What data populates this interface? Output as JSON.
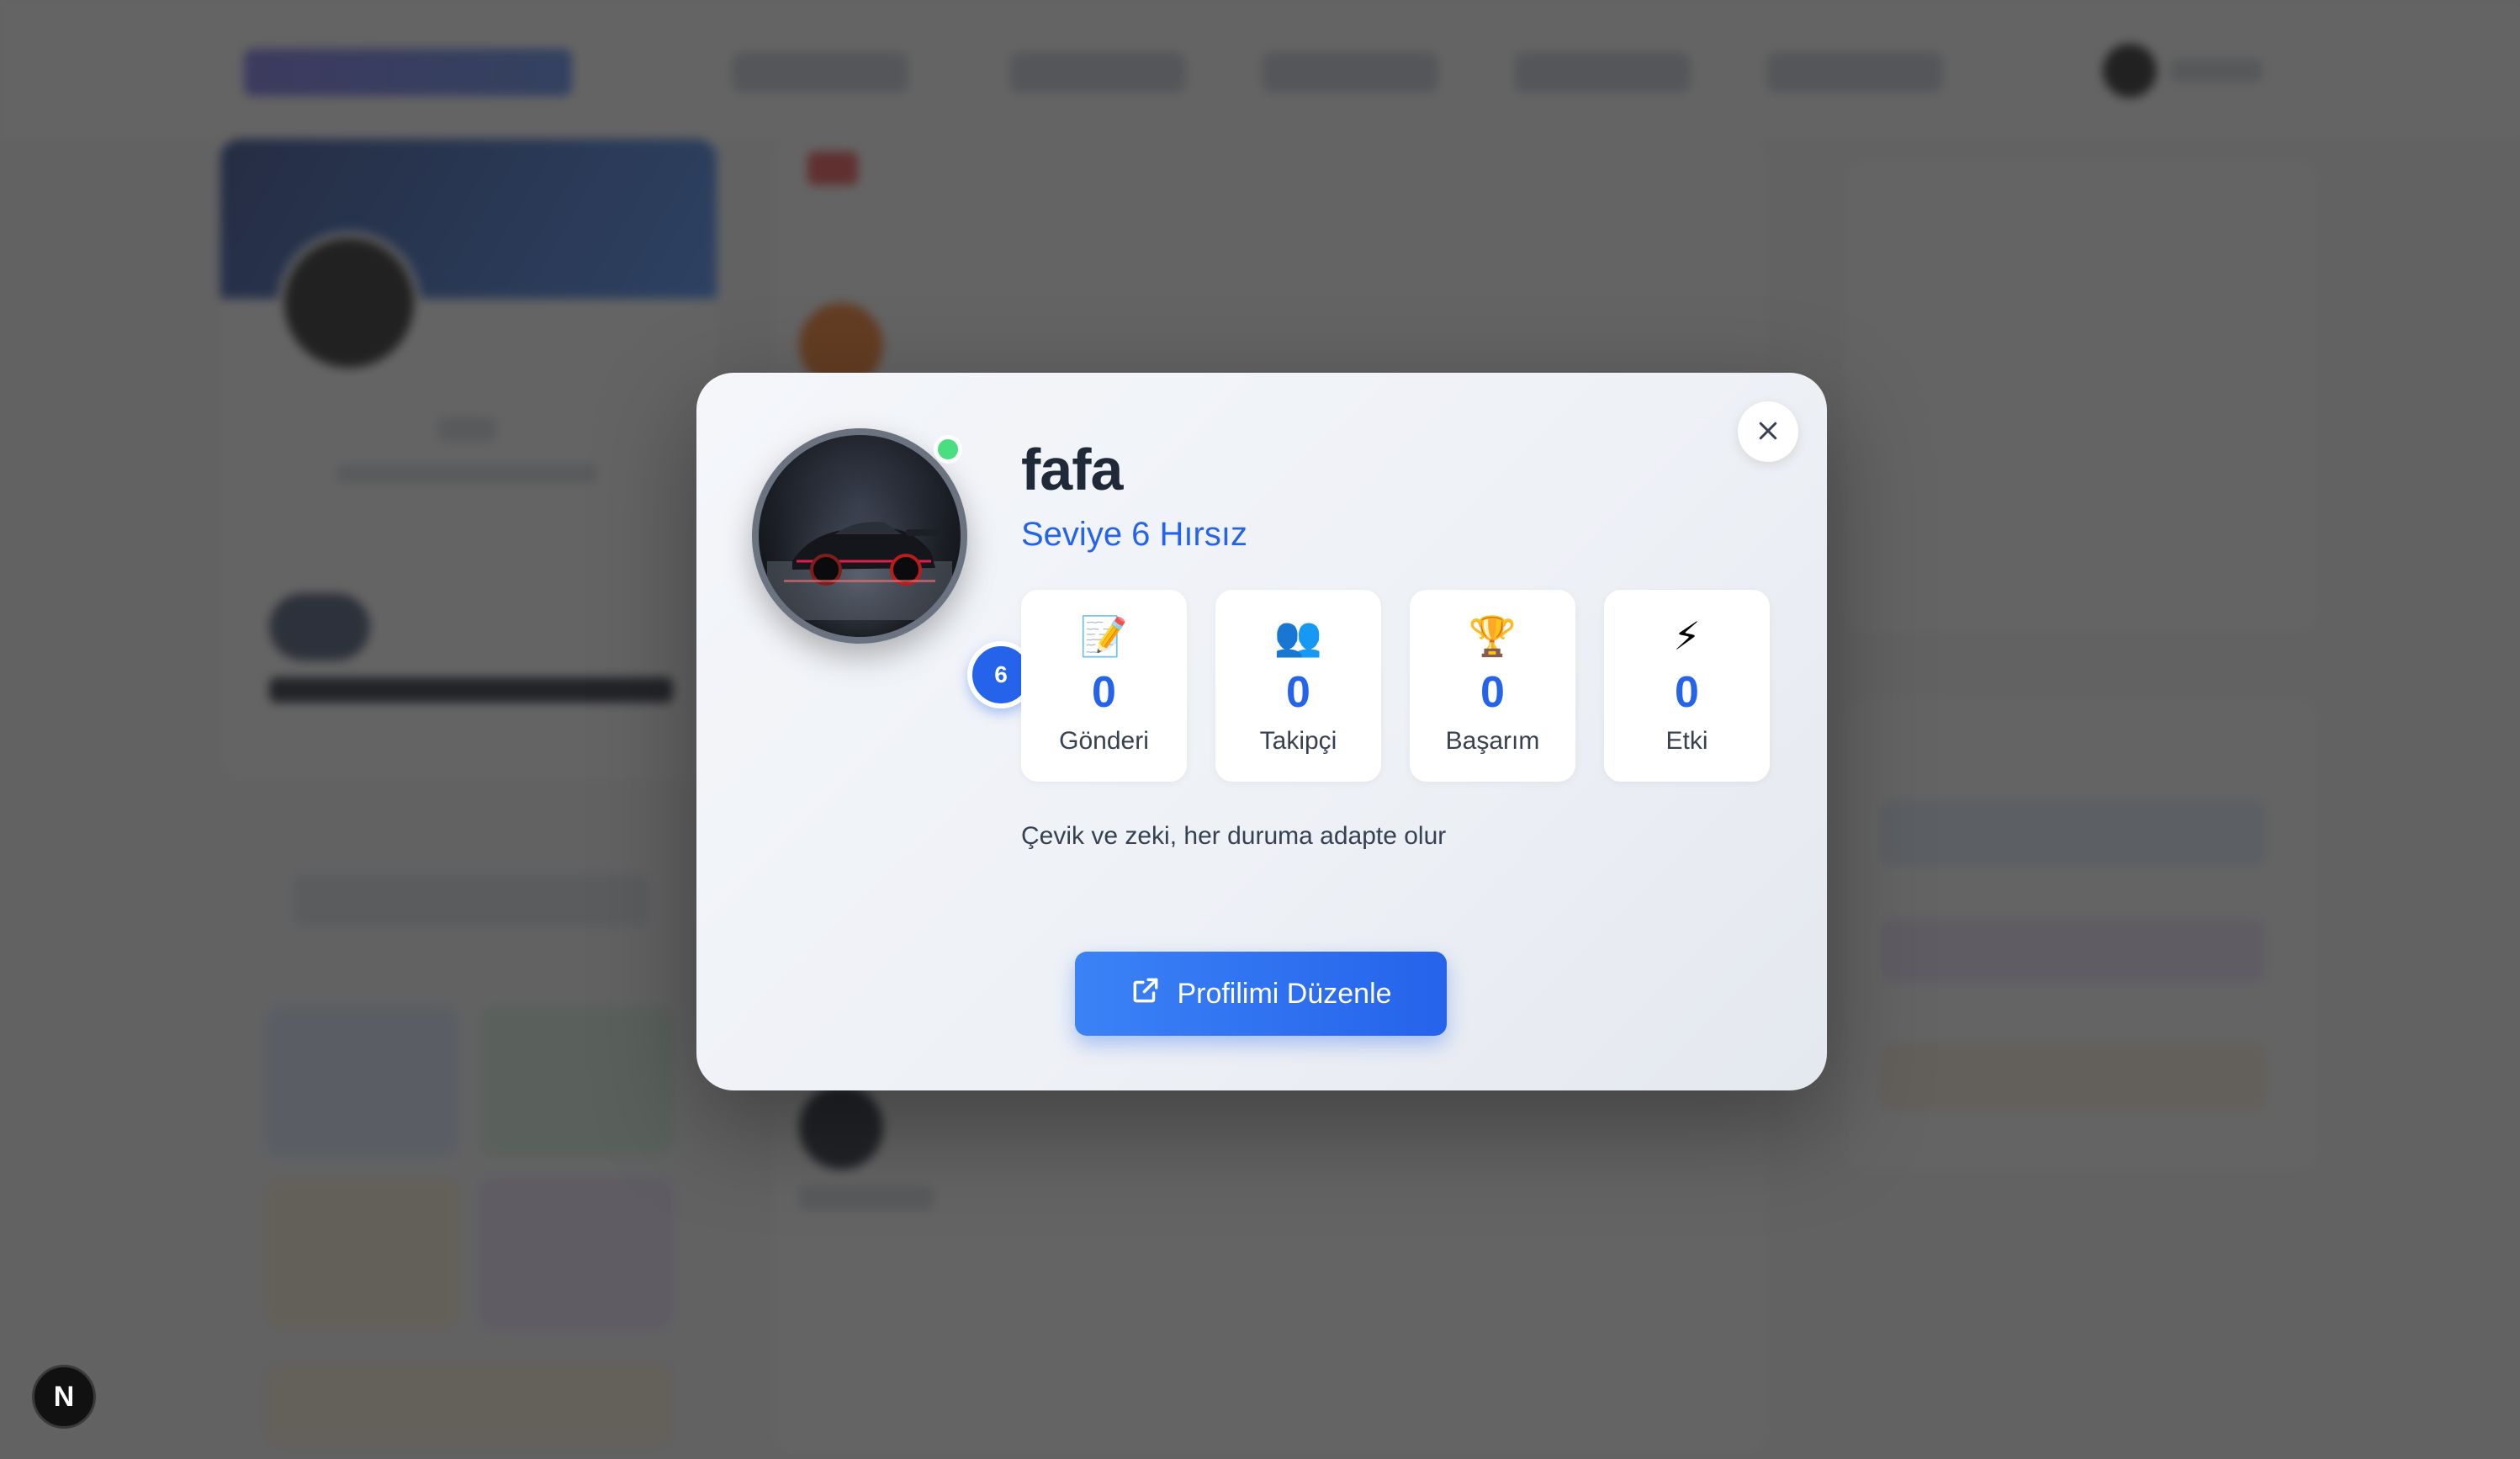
{
  "profile_modal": {
    "username": "fafa",
    "level_title": "Seviye 6 Hırsız",
    "level_badge": "6",
    "online": true,
    "stats": [
      {
        "icon": "📝",
        "icon_name": "memo-icon",
        "value": "0",
        "label": "Gönderi"
      },
      {
        "icon": "👥",
        "icon_name": "users-icon",
        "value": "0",
        "label": "Takipçi"
      },
      {
        "icon": "🏆",
        "icon_name": "trophy-icon",
        "value": "0",
        "label": "Başarım"
      },
      {
        "icon": "⚡",
        "icon_name": "lightning-icon",
        "value": "0",
        "label": "Etki"
      }
    ],
    "bio": "Çevik ve zeki, her duruma adapte olur",
    "edit_button_label": "Profilimi Düzenle"
  },
  "dev_badge": {
    "label": "N"
  },
  "colors": {
    "accent": "#2563eb",
    "online": "#4ade80",
    "overlay": "#282828"
  }
}
